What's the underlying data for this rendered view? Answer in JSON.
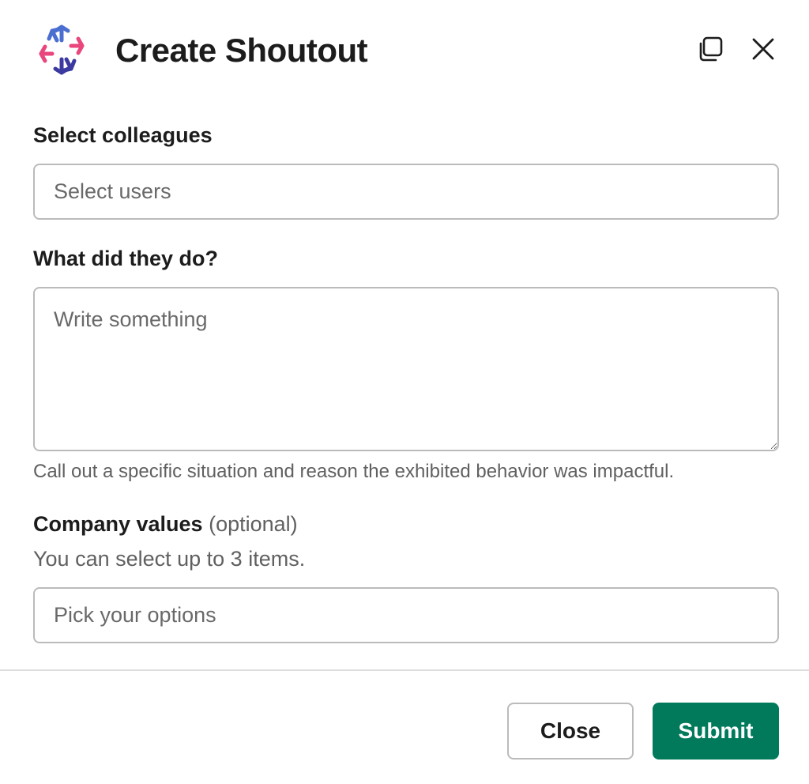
{
  "modal": {
    "title": "Create Shoutout"
  },
  "icons": {
    "logo": "hexagon-star-logo",
    "copy": "duplicate-window-icon",
    "close": "close-icon"
  },
  "colleagues": {
    "label": "Select colleagues",
    "placeholder": "Select users",
    "value": ""
  },
  "description": {
    "label": "What did they do?",
    "placeholder": "Write something",
    "value": "",
    "help": "Call out a specific situation and reason the exhibited behavior was impactful."
  },
  "values": {
    "label": "Company values",
    "optional": "(optional)",
    "hint": "You can select up to 3 items.",
    "placeholder": "Pick your options",
    "value": ""
  },
  "footer": {
    "close_label": "Close",
    "submit_label": "Submit"
  },
  "colors": {
    "submit": "#007a5a",
    "logo_pink": "#e8467c",
    "logo_blue": "#4a6fd0",
    "logo_navy": "#3b3aa0"
  }
}
